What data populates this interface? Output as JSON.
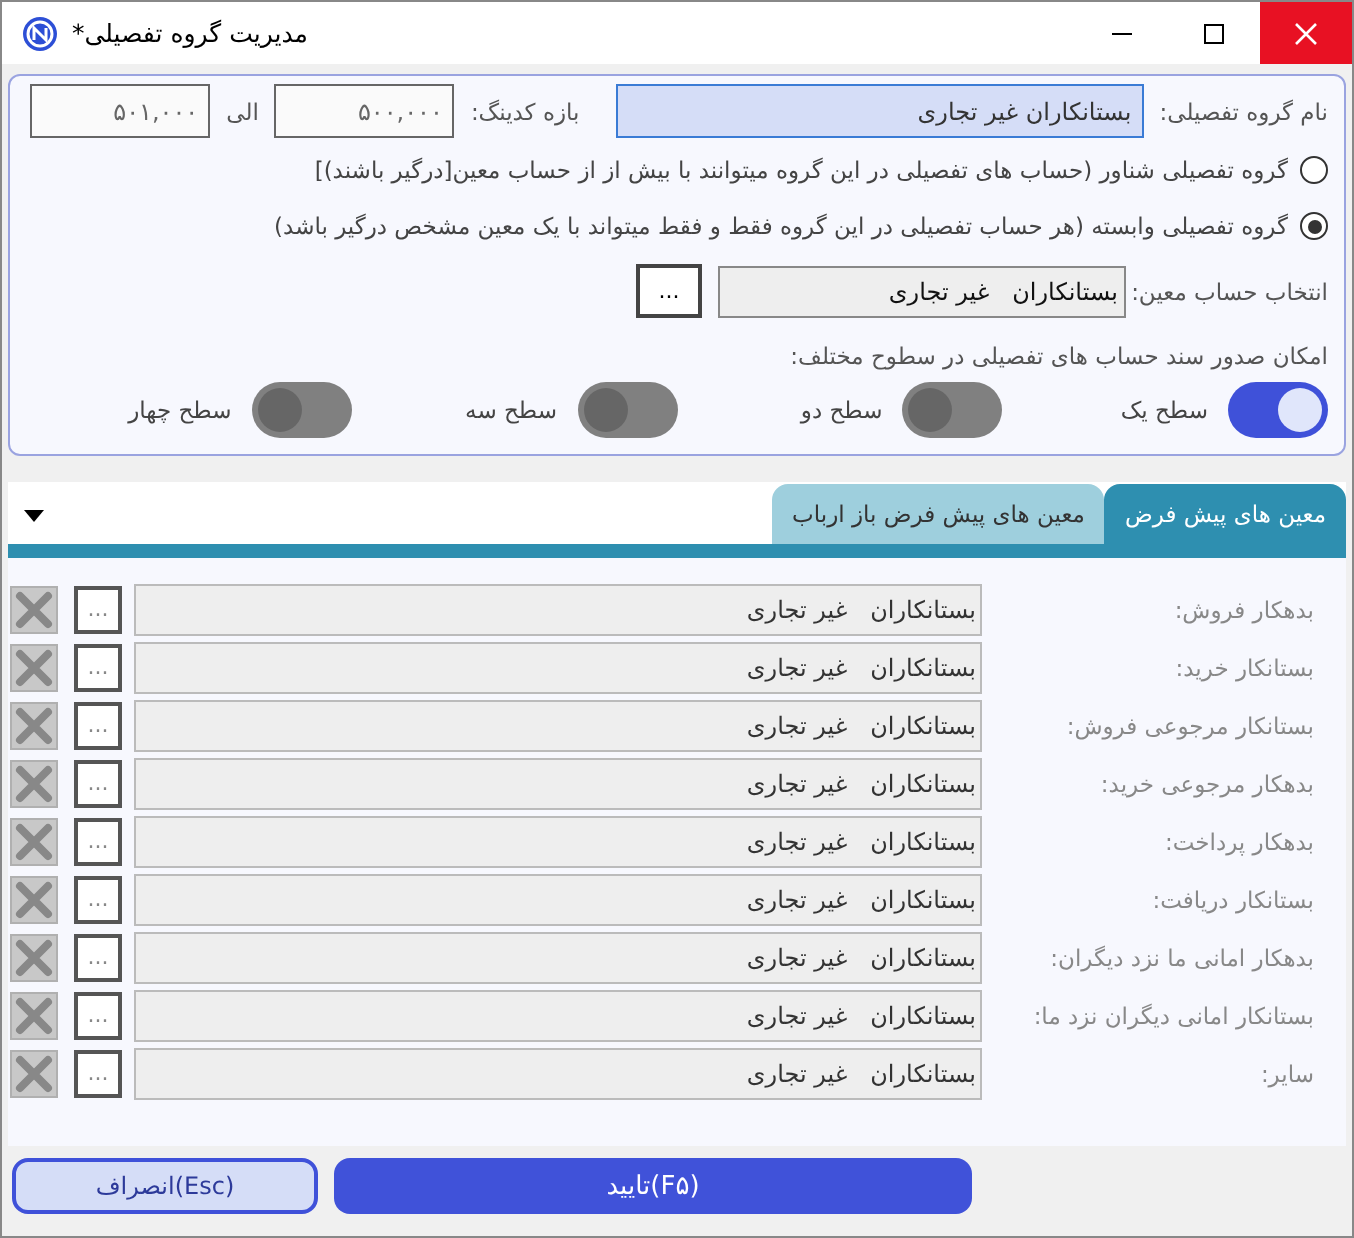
{
  "window": {
    "title": "مدیریت گروه تفصیلی*"
  },
  "group_name": {
    "label": "نام گروه تفصیلی:",
    "value": "بستانکاران غیر تجاری"
  },
  "coding_range": {
    "label": "بازه کدینگ:",
    "from": "۵۰۰,۰۰۰",
    "to_label": "الی",
    "to": "۵۰۱,۰۰۰"
  },
  "group_types": [
    {
      "label": "گروه تفصیلی شناور (حساب های تفصیلی در این گروه میتوانند با بیش از از حساب معین[درگیر باشند)]",
      "selected": false
    },
    {
      "label": "گروه تفصیلی وابسته (هر حساب تفصیلی در این گروه فقط و فقط میتواند با یک معین مشخص درگیر باشد)",
      "selected": true
    }
  ],
  "account": {
    "label": "انتخاب حساب معین:",
    "value": "بستانکاران   غیر تجاری",
    "button": "..."
  },
  "levels": {
    "label": "امکان صدور سند حساب های تفصیلی در سطوح مختلف:",
    "toggles": [
      {
        "label": "سطح یک",
        "on": true
      },
      {
        "label": "سطح دو",
        "on": false
      },
      {
        "label": "سطح سه",
        "on": false
      },
      {
        "label": "سطح چهار",
        "on": false
      }
    ]
  },
  "tabs": [
    {
      "label": "معین های پیش فرض",
      "selected": true
    },
    {
      "label": "معین های پیش فرض باز ارباب",
      "selected": false
    }
  ],
  "defaults": [
    {
      "label": "بدهکار فروش:",
      "value": "بستانکاران   غیر تجاری",
      "button": "..."
    },
    {
      "label": "بستانکار خرید:",
      "value": "بستانکاران   غیر تجاری",
      "button": "..."
    },
    {
      "label": "بستانکار مرجوعی فروش:",
      "value": "بستانکاران   غیر تجاری",
      "button": "..."
    },
    {
      "label": "بدهکار مرجوعی خرید:",
      "value": "بستانکاران   غیر تجاری",
      "button": "..."
    },
    {
      "label": "بدهکار پرداخت:",
      "value": "بستانکاران   غیر تجاری",
      "button": "..."
    },
    {
      "label": "بستانکار دریافت:",
      "value": "بستانکاران   غیر تجاری",
      "button": "..."
    },
    {
      "label": "بدهکار امانی ما نزد دیگران:",
      "value": "بستانکاران   غیر تجاری",
      "button": "..."
    },
    {
      "label": "بستانکار امانی دیگران نزد ما:",
      "value": "بستانکاران   غیر تجاری",
      "button": "..."
    },
    {
      "label": "سایر:",
      "value": "بستانکاران   غیر تجاری",
      "button": "..."
    }
  ],
  "buttons": {
    "confirm": "تایید(F۵)",
    "cancel": "انصراف(Esc)"
  }
}
